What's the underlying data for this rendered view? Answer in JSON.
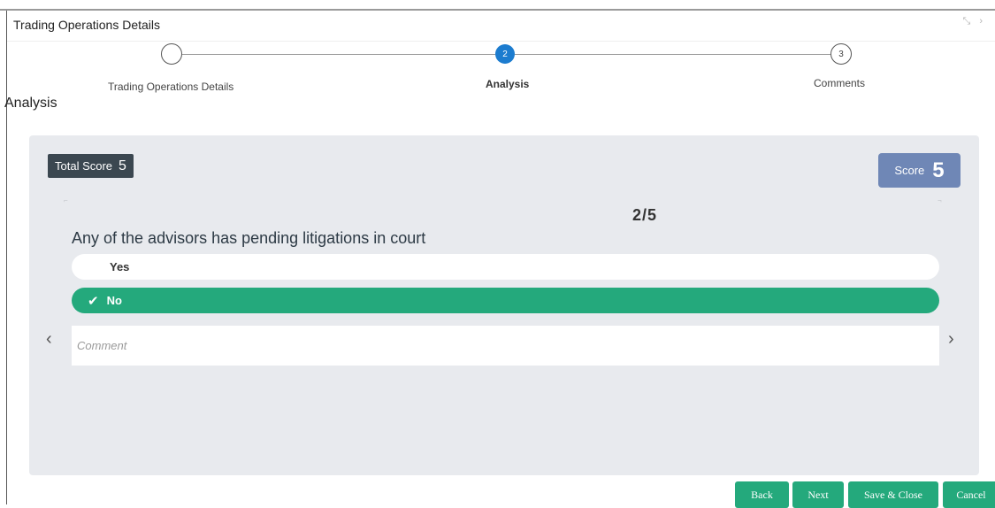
{
  "window": {
    "title": "Trading Operations Details",
    "icons": [
      "collapse-icon",
      "close-icon"
    ]
  },
  "stepper": {
    "steps": [
      {
        "number": "",
        "label": "Trading Operations Details",
        "state": "done"
      },
      {
        "number": "2",
        "label": "Analysis",
        "state": "active"
      },
      {
        "number": "3",
        "label": "Comments",
        "state": "pending"
      }
    ]
  },
  "section_label": "Analysis",
  "scorecard": {
    "total_score_label": "Total Score",
    "total_score_value": "5",
    "score_label": "Score",
    "score_value": "5",
    "counter": "2/5",
    "question": "Any of the advisors has pending litigations in court",
    "options": [
      {
        "label": "Yes",
        "selected": false
      },
      {
        "label": "No",
        "selected": true
      }
    ],
    "comment": {
      "value": "",
      "placeholder": "Comment"
    }
  },
  "footer": {
    "back_label": "Back",
    "next_label": "Next",
    "save_close_label": "Save & Close",
    "cancel_label": "Cancel"
  },
  "colors": {
    "accent": "#24a97c",
    "active_step": "#1c7ccf",
    "score_badge": "#6f87b6",
    "total_score_badge": "#3b4750"
  }
}
